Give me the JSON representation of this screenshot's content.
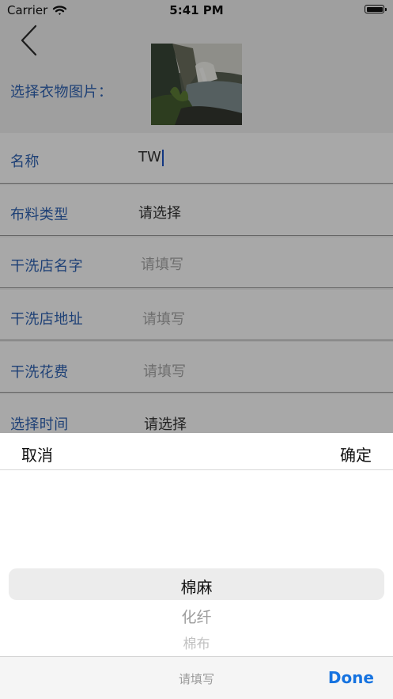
{
  "status_bar": {
    "carrier": "Carrier",
    "time": "5:41 PM"
  },
  "form": {
    "photo_label": "选择衣物图片：",
    "rows": [
      {
        "label": "名称",
        "value": "TW"
      },
      {
        "label": "布料类型",
        "value": "请选择"
      },
      {
        "label": "干洗店名字",
        "placeholder": "请填写"
      },
      {
        "label": "干洗店地址",
        "placeholder": "请填写"
      },
      {
        "label": "干洗花费",
        "placeholder": "请填写"
      },
      {
        "label": "选择时间",
        "value": "请选择"
      }
    ]
  },
  "picker": {
    "cancel_label": "取消",
    "confirm_label": "确定",
    "options": [
      "棉麻",
      "化纤",
      "棉布"
    ],
    "selected": "棉麻"
  },
  "accessory": {
    "placeholder": "请填写",
    "done_label": "Done"
  },
  "colors": {
    "form_label": "#2f63b4",
    "done": "#1673e0",
    "cursor": "#1a52c6"
  },
  "icons": {
    "back": "chevron-left-icon",
    "wifi": "wifi-icon",
    "battery": "battery-icon"
  }
}
